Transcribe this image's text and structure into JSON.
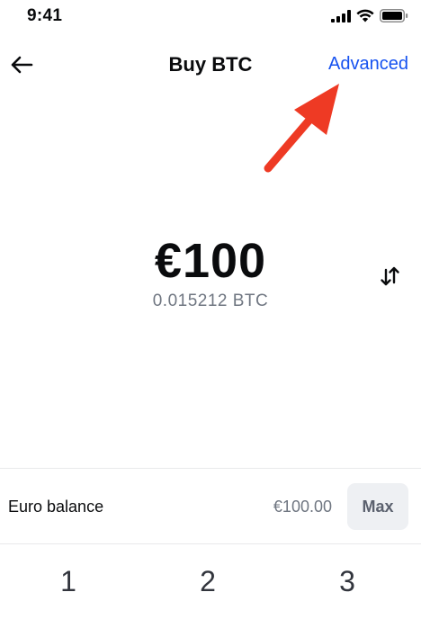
{
  "status_bar": {
    "time": "9:41",
    "icons": [
      "signal-icon",
      "wifi-icon",
      "battery-icon"
    ]
  },
  "header": {
    "back_icon": "arrow-left-icon",
    "title": "Buy BTC",
    "advanced_label": "Advanced"
  },
  "annotation": {
    "icon": "red-arrow-icon",
    "color": "#ee3a24"
  },
  "amount": {
    "fiat": "€100",
    "crypto": "0.015212 BTC",
    "swap_icon": "swap-vertical-icon"
  },
  "balance": {
    "label": "Euro balance",
    "value": "€100.00",
    "max_label": "Max"
  },
  "keypad": {
    "keys": [
      "1",
      "2",
      "3"
    ]
  },
  "colors": {
    "accent": "#1652f0",
    "text": "#0a0b0d",
    "muted": "#6f7681",
    "button_bg": "#eef0f3",
    "divider": "#e8e9eb"
  }
}
